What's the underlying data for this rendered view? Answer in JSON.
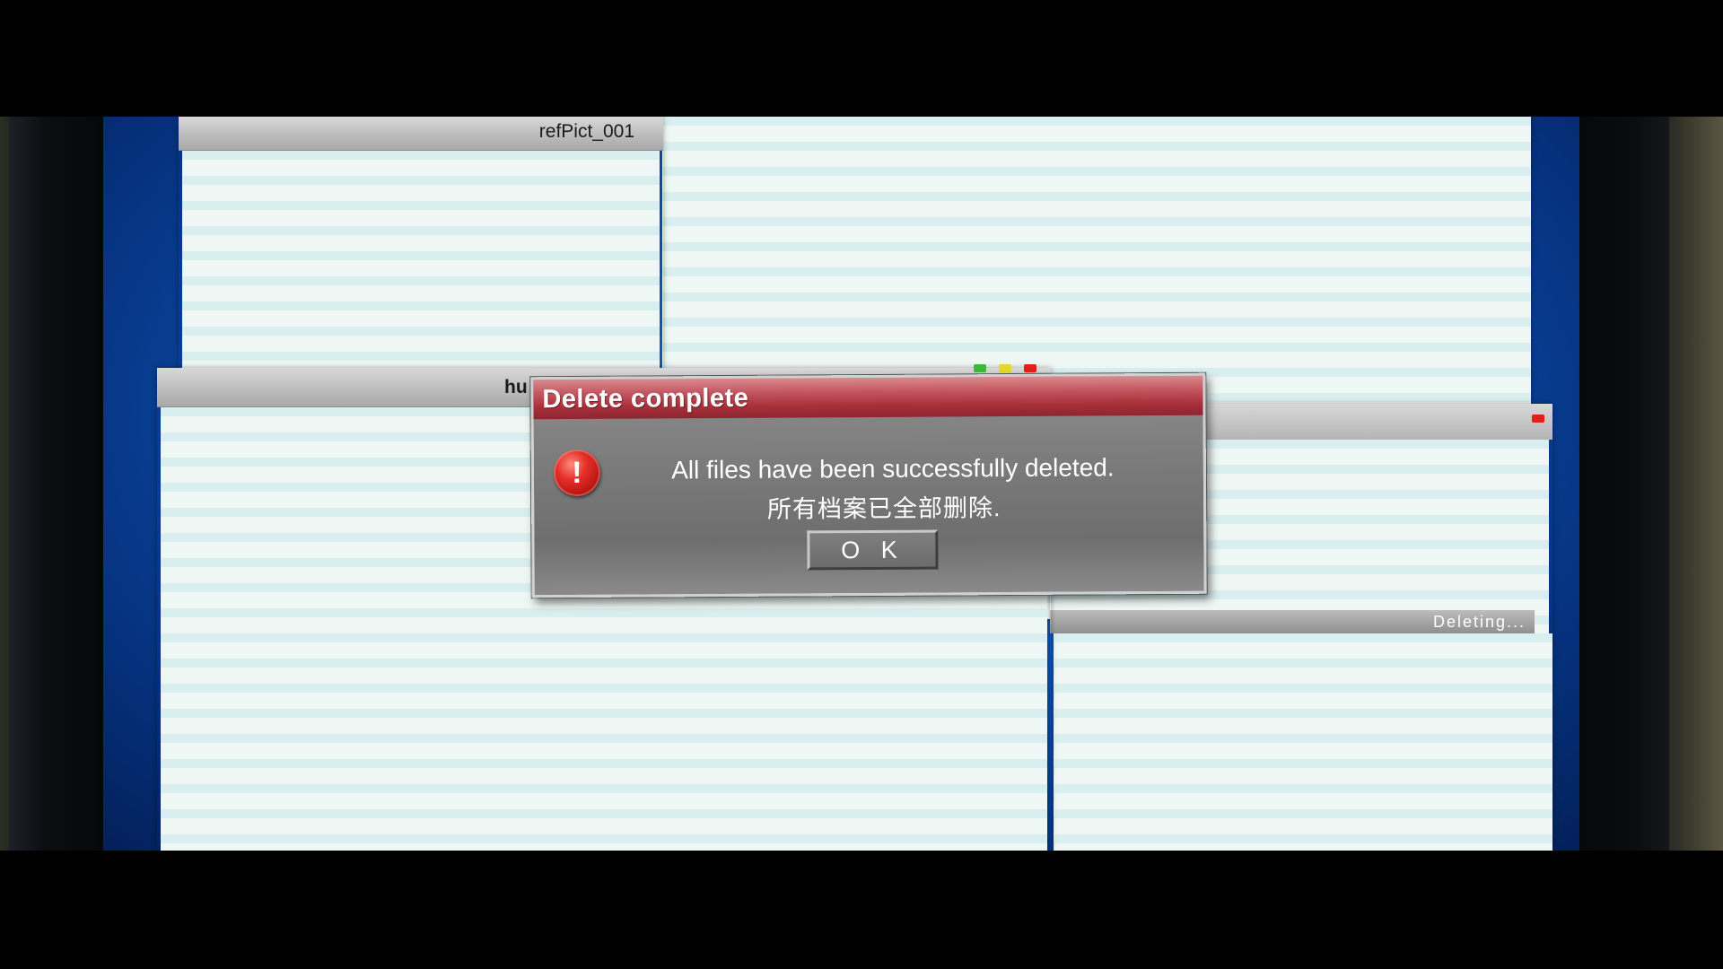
{
  "windows": {
    "ref_pict": {
      "title": "refPict_001"
    },
    "main": {
      "title_fragment": "hu"
    },
    "deleting": {
      "status": "Deleting..."
    }
  },
  "dialog": {
    "title": "Delete complete",
    "message_en": "All files have been successfully deleted.",
    "message_zh": "所有档案已全部删除.",
    "ok_label": "O K",
    "icon": "exclamation-icon"
  },
  "colors": {
    "desktop_blue": "#0d4fb0",
    "dialog_title_red": "#c45660",
    "stripe_cyan": "#d9eeee"
  }
}
